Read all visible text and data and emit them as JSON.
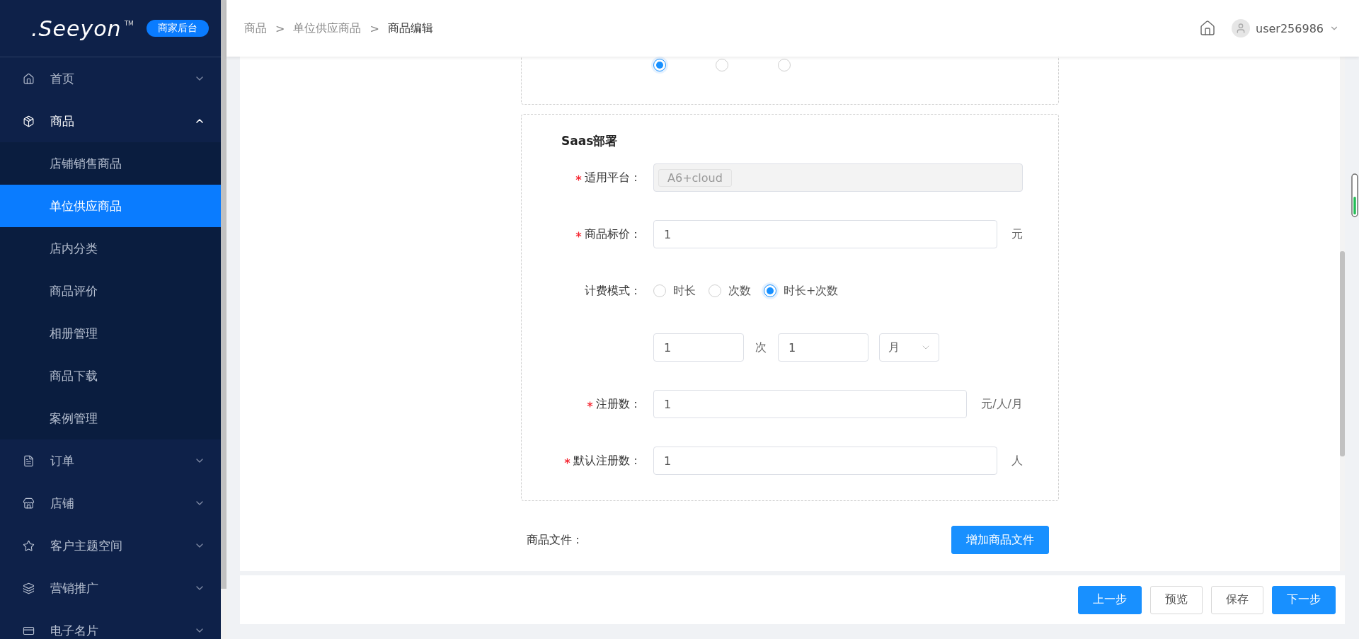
{
  "sidebar": {
    "logo": {
      "wordmark": ".Seeyon",
      "trademark": "TM",
      "badge": "商家后台"
    },
    "menu": [
      {
        "label": "首页",
        "expanded": false
      },
      {
        "label": "商品",
        "expanded": true,
        "children": [
          {
            "label": "店铺销售商品",
            "selected": false
          },
          {
            "label": "单位供应商品",
            "selected": true
          },
          {
            "label": "店内分类",
            "selected": false
          },
          {
            "label": "商品评价",
            "selected": false
          },
          {
            "label": "相册管理",
            "selected": false
          },
          {
            "label": "商品下载",
            "selected": false
          },
          {
            "label": "案例管理",
            "selected": false
          }
        ]
      },
      {
        "label": "订单",
        "expanded": false
      },
      {
        "label": "店铺",
        "expanded": false
      },
      {
        "label": "客户主题空间",
        "expanded": false
      },
      {
        "label": "营销推广",
        "expanded": false
      },
      {
        "label": "电子名片",
        "expanded": false
      }
    ]
  },
  "header": {
    "breadcrumb": [
      {
        "label": "商品",
        "current": false
      },
      {
        "label": "单位供应商品",
        "current": false
      },
      {
        "label": "商品编辑",
        "current": true
      }
    ],
    "separators": [
      ">",
      ">"
    ],
    "user": "user256986"
  },
  "form": {
    "previous_section": {
      "radios": [
        {
          "selected": true
        },
        {
          "selected": false
        },
        {
          "selected": false
        }
      ]
    },
    "section": {
      "title": "Saas部署",
      "fields": [
        {
          "kind": "tags",
          "label": "适用平台：",
          "required": true,
          "disabled": true,
          "tags": [
            "A6+cloud"
          ]
        },
        {
          "kind": "input",
          "label": "商品标价：",
          "required": true,
          "value": "1",
          "unit": "元"
        },
        {
          "kind": "radio",
          "label": "计费模式：",
          "options": [
            {
              "label": "时长",
              "selected": false
            },
            {
              "label": "次数",
              "selected": false
            },
            {
              "label": "时长+次数",
              "selected": true
            }
          ]
        },
        {
          "kind": "combo",
          "inputs": [
            "1",
            "1"
          ],
          "joiner": "次",
          "select": "月"
        },
        {
          "kind": "input",
          "label": "注册数：",
          "required": true,
          "value": "1",
          "unit": "元/人/月"
        },
        {
          "kind": "input",
          "label": "默认注册数：",
          "required": true,
          "value": "1",
          "unit": "人"
        }
      ]
    },
    "files": {
      "label": "商品文件：",
      "button": "增加商品文件"
    }
  },
  "footer": {
    "buttons": [
      {
        "label": "上一步",
        "kind": "primary"
      },
      {
        "label": "预览",
        "kind": "default"
      },
      {
        "label": "保存",
        "kind": "default"
      },
      {
        "label": "下一步",
        "kind": "primary"
      }
    ]
  }
}
